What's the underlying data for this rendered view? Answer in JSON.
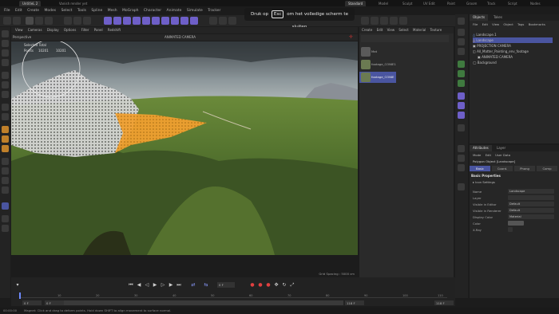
{
  "titlebar": {
    "tabs": [
      "UntitleL 2",
      "Vanish render yet",
      "Standard",
      "Model",
      "Sculpt",
      "UV Edit",
      "Paint",
      "Groom",
      "Track",
      "Script",
      "Nodes"
    ]
  },
  "menubar": {
    "items": [
      "File",
      "Edit",
      "Create",
      "Modes",
      "Select",
      "Tools",
      "Spline",
      "Mesh",
      "MoGraph",
      "Character",
      "Animate",
      "Simulate",
      "Tracker",
      "Render",
      "Extension"
    ]
  },
  "overlay": {
    "pre": "Druk op",
    "key": "Esc",
    "post": "om het volledige scherm te sluiten"
  },
  "viewport": {
    "menu": [
      "View",
      "Cameras",
      "Display",
      "Options",
      "Filter",
      "Panel",
      "Redshift"
    ],
    "label": "Perspective",
    "camera": "ANIMATED CAMERA",
    "selected": "Selected Total",
    "points_label": "Points",
    "points_value": "10201",
    "points_total": "10201",
    "grid_spacing": "Grid Spacing : 5000 cm"
  },
  "assets": {
    "menu": [
      "Create",
      "Edit",
      "View",
      "Select",
      "Material",
      "Texture"
    ],
    "items": [
      "Mat",
      "footage_CONIE1",
      "footage_CONIE"
    ]
  },
  "objects": {
    "tabs": [
      "Objects",
      "Takes"
    ],
    "menu": [
      "File",
      "Edit",
      "View",
      "Object",
      "Tags",
      "Bookmarks"
    ],
    "rows": [
      "Landscape.1",
      "Landscape",
      "PROJECTION CAMERA",
      "All_Matter_Painting_env_footage",
      "ANIMATED CAMERA",
      "Background"
    ]
  },
  "attributes": {
    "tabs": [
      "Attributes",
      "Layer"
    ],
    "menu": [
      "Mode",
      "Edit",
      "User Data"
    ],
    "object_title": "Polygon Object [Landscape]",
    "subtabs": [
      "Basic",
      "Coord.",
      "Phong",
      "Comp"
    ],
    "section": "Basic Properties",
    "subsection": "Icon Settings",
    "rows": [
      {
        "label": "Name",
        "value": "Landscape"
      },
      {
        "label": "Layer",
        "value": ""
      },
      {
        "label": "Visible in Editor",
        "value": "Default"
      },
      {
        "label": "Visible in Renderer",
        "value": "Default"
      },
      {
        "label": "Display Color",
        "value": "Material"
      },
      {
        "label": "Color",
        "value": ""
      },
      {
        "label": "X-Ray",
        "value": ""
      }
    ]
  },
  "timeline": {
    "frame_field": "0 F",
    "start": "0 F",
    "start2": "0 F",
    "end": "118 F",
    "end2": "118 F",
    "ruler": [
      "0",
      "10",
      "20",
      "30",
      "40",
      "50",
      "60",
      "70",
      "80",
      "90",
      "100",
      "110"
    ]
  },
  "status": {
    "time": "00:00:00",
    "message": "Magnet: Click and drag to deform points. Hold down SHIFT to align movement to surface normal."
  },
  "colors": {
    "accent": "#6e5fc8",
    "selection": "#f0a030",
    "blue_select": "#4a55a0"
  }
}
